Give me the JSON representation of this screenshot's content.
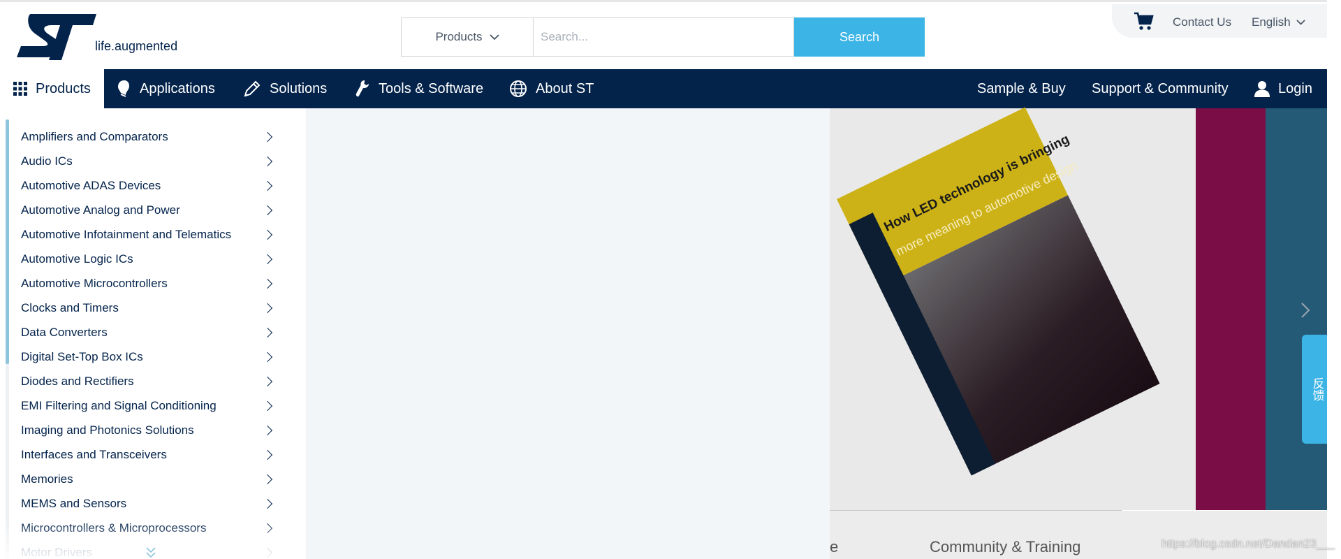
{
  "header": {
    "tagline": "life.augmented",
    "search": {
      "category": "Products",
      "placeholder": "Search...",
      "button": "Search"
    },
    "utility": {
      "contact": "Contact Us",
      "language": "English"
    }
  },
  "nav": {
    "products": "Products",
    "applications": "Applications",
    "solutions": "Solutions",
    "tools": "Tools & Software",
    "about": "About ST",
    "sample": "Sample & Buy",
    "support": "Support & Community",
    "login": "Login"
  },
  "menu": {
    "items": [
      "Amplifiers and Comparators",
      "Audio ICs",
      "Automotive ADAS Devices",
      "Automotive Analog and Power",
      "Automotive Infotainment and Telematics",
      "Automotive Logic ICs",
      "Automotive Microcontrollers",
      "Clocks and Timers",
      "Data Converters",
      "Digital Set-Top Box ICs",
      "Diodes and Rectifiers",
      "EMI Filtering and Signal Conditioning",
      "Imaging and Photonics Solutions",
      "Interfaces and Transceivers",
      "Memories",
      "MEMS and Sensors",
      "Microcontrollers & Microprocessors",
      "Motor Drivers"
    ]
  },
  "background": {
    "brochure_title": "How LED technology is bringing",
    "brochure_subtitle": "more meaning to automotive design",
    "section_fragment": "e",
    "section_community": "Community & Training"
  },
  "feedback": "反馈",
  "watermark": "https://blog.csdn.net/Dandan23___",
  "colors": {
    "brand_dark": "#03234b",
    "accent": "#3cb4e6",
    "magenta": "#7a0d46",
    "teal": "#245a76"
  }
}
